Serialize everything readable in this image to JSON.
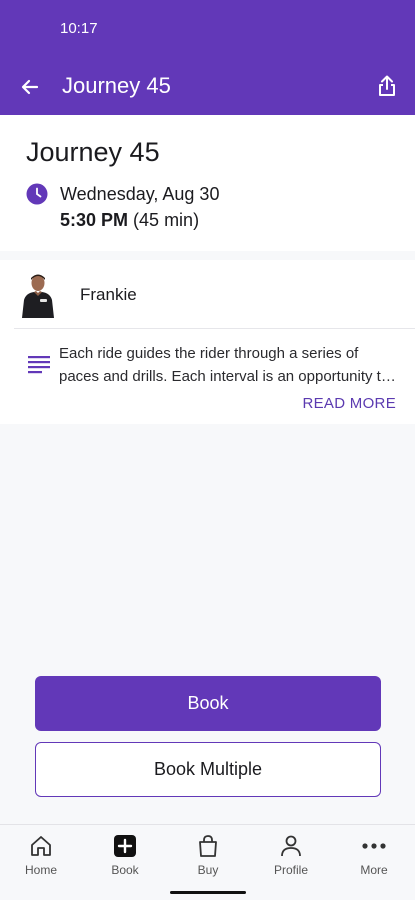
{
  "status_bar": {
    "time": "10:17"
  },
  "app_bar": {
    "title": "Journey 45"
  },
  "class": {
    "title": "Journey 45",
    "date": "Wednesday, Aug 30",
    "time": "5:30 PM",
    "duration": "(45 min)"
  },
  "instructor": {
    "name": "Frankie"
  },
  "description": {
    "text": "Each ride guides the rider through a series of paces and drills. Each interval is an opportunity to challenge yourself.",
    "read_more": "READ MORE"
  },
  "actions": {
    "book": "Book",
    "book_multiple": "Book Multiple"
  },
  "nav": {
    "items": [
      {
        "label": "Home",
        "icon": "home-icon"
      },
      {
        "label": "Book",
        "icon": "add-box-icon"
      },
      {
        "label": "Buy",
        "icon": "shopping-bag-icon"
      },
      {
        "label": "Profile",
        "icon": "person-icon"
      },
      {
        "label": "More",
        "icon": "more-dots-icon"
      }
    ]
  },
  "colors": {
    "brand": "#6238b8",
    "link": "#5b3ab0"
  }
}
